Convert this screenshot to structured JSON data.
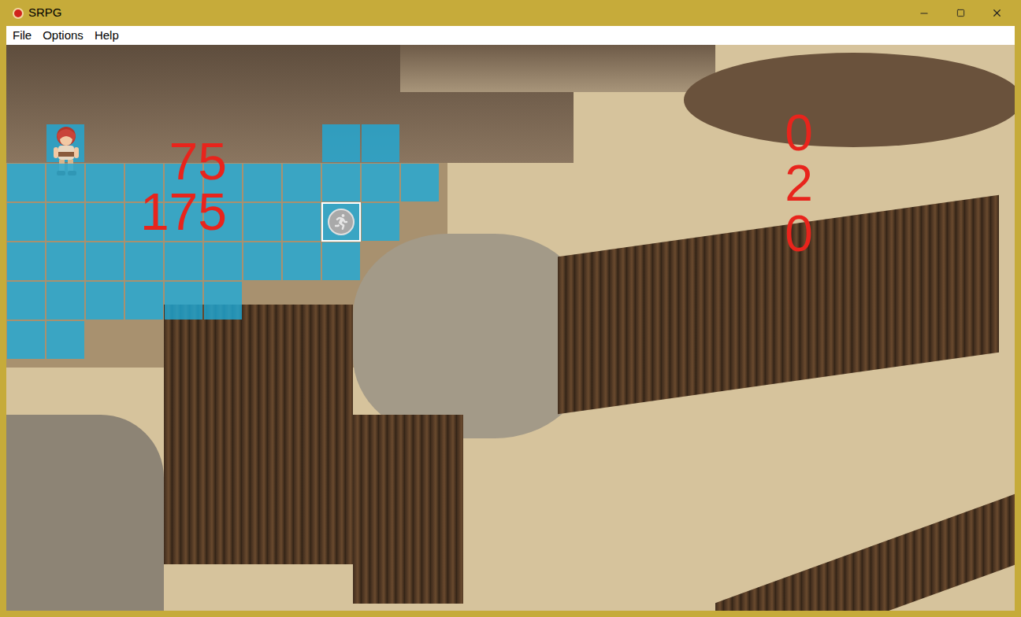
{
  "window": {
    "title": "SRPG"
  },
  "menu": [
    "File",
    "Options",
    "Help"
  ],
  "hud": {
    "left_stats": [
      "75",
      "175"
    ],
    "right_stats": [
      "0",
      "2",
      "0"
    ]
  },
  "move_range": [
    [
      false,
      false,
      false,
      false,
      false,
      false,
      false,
      false,
      false,
      false,
      false
    ],
    [
      false,
      false,
      false,
      false,
      false,
      false,
      false,
      false,
      false,
      false,
      false
    ],
    [
      false,
      true,
      false,
      false,
      false,
      false,
      false,
      false,
      true,
      true,
      false
    ],
    [
      true,
      true,
      true,
      true,
      true,
      true,
      true,
      true,
      true,
      true,
      true
    ],
    [
      true,
      true,
      true,
      true,
      true,
      true,
      true,
      true,
      true,
      true,
      false
    ],
    [
      true,
      true,
      true,
      true,
      true,
      true,
      true,
      true,
      true,
      false,
      false
    ],
    [
      true,
      true,
      true,
      true,
      true,
      true,
      false,
      false,
      false,
      false,
      false
    ],
    [
      true,
      true,
      false,
      false,
      false,
      false,
      false,
      false,
      false,
      false,
      false
    ]
  ],
  "cursor": {
    "row": 4,
    "col": 8
  },
  "units": [
    {
      "row": 2,
      "col": 1,
      "team": "player"
    }
  ]
}
